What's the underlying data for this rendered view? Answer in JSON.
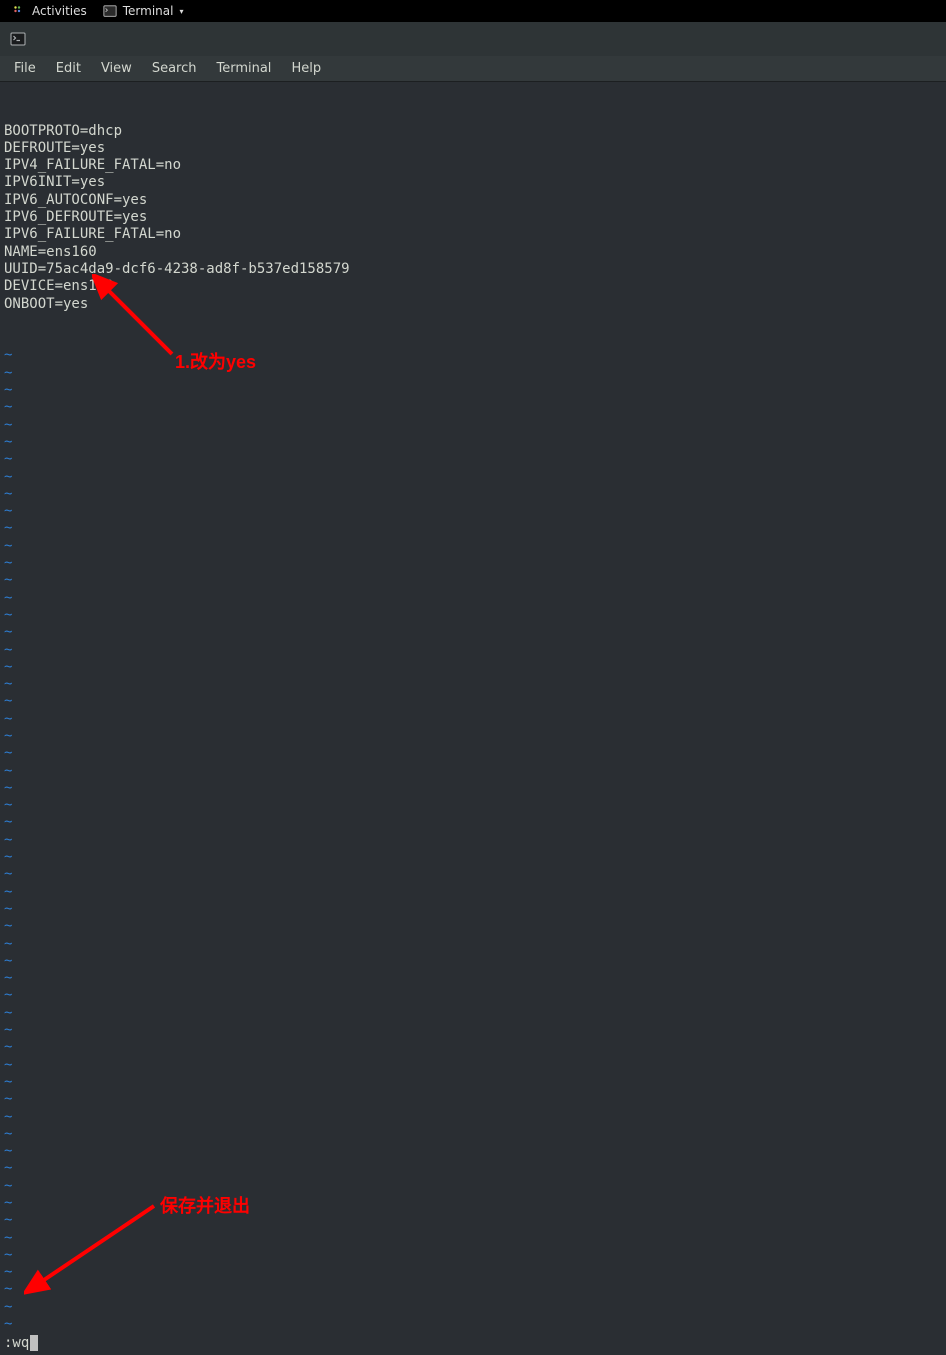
{
  "topbar": {
    "activities": "Activities",
    "app_label": "Terminal",
    "dropdown_glyph": "▾"
  },
  "menubar": {
    "file": "File",
    "edit": "Edit",
    "view": "View",
    "search": "Search",
    "terminal": "Terminal",
    "help": "Help"
  },
  "config_lines": [
    "BOOTPROTO=dhcp",
    "DEFROUTE=yes",
    "IPV4_FAILURE_FATAL=no",
    "IPV6INIT=yes",
    "IPV6_AUTOCONF=yes",
    "IPV6_DEFROUTE=yes",
    "IPV6_FAILURE_FATAL=no",
    "NAME=ens160",
    "UUID=75ac4da9-dcf6-4238-ad8f-b537ed158579",
    "DEVICE=ens160",
    "ONBOOT=yes"
  ],
  "tilde_count": 57,
  "vim_command": ":wq",
  "annotations": {
    "anno1": "1.改为yes",
    "anno2": "保存并退出"
  }
}
